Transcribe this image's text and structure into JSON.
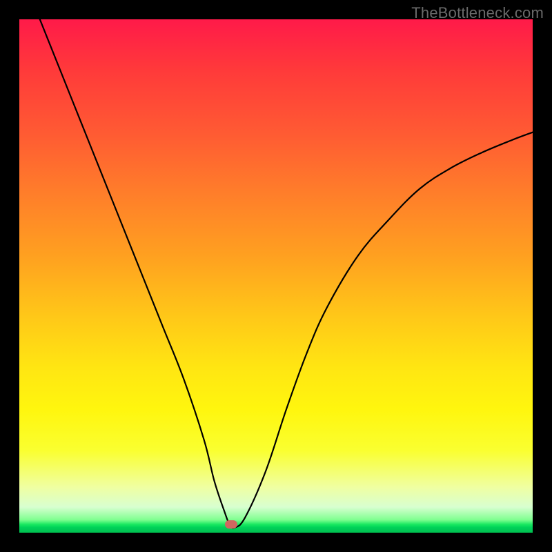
{
  "watermark": "TheBottleneck.com",
  "chart_data": {
    "type": "line",
    "title": "",
    "xlabel": "",
    "ylabel": "",
    "xlim": [
      0,
      100
    ],
    "ylim": [
      0,
      100
    ],
    "grid": false,
    "legend": false,
    "series": [
      {
        "name": "bottleneck-curve",
        "x": [
          4,
          8,
          12,
          16,
          20,
          24,
          28,
          32,
          36,
          38,
          40,
          41,
          42,
          44,
          48,
          52,
          56,
          60,
          66,
          72,
          78,
          84,
          90,
          96,
          100
        ],
        "y": [
          100,
          90,
          80,
          70,
          60,
          50,
          40,
          30,
          18,
          10,
          4,
          1.5,
          1,
          3,
          12,
          24,
          35,
          44,
          54,
          61,
          67,
          71,
          74,
          76.5,
          78
        ]
      }
    ],
    "marker": {
      "x": 41.3,
      "y": 1.6,
      "color": "#cf6760"
    },
    "background_gradient": {
      "top": "#ff1a49",
      "mid": "#ffe612",
      "bottom": "#00c050"
    }
  }
}
